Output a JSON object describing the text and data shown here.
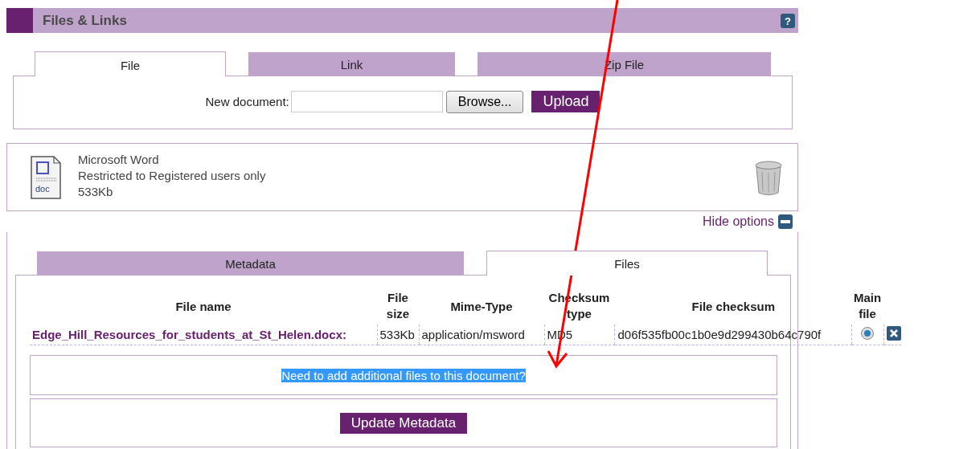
{
  "header": {
    "title": "Files & Links",
    "help": "?"
  },
  "tabs": [
    {
      "label": "File",
      "selected": true
    },
    {
      "label": "Link",
      "selected": false
    },
    {
      "label": "Zip File",
      "selected": false
    }
  ],
  "upload": {
    "label": "New document:",
    "browse": "Browse...",
    "submit": "Upload"
  },
  "document": {
    "type": "Microsoft Word",
    "access": "Restricted to Registered users only",
    "size": "533Kb",
    "icon_label": "doc"
  },
  "hide_options": "Hide options",
  "inner_tabs": [
    {
      "label": "Metadata",
      "selected": false
    },
    {
      "label": "Files",
      "selected": true
    }
  ],
  "table": {
    "columns": [
      "File name",
      "File size",
      "Mime-Type",
      "Checksum type",
      "File checksum",
      "Main file"
    ],
    "rows": [
      {
        "file_name": "Edge_Hill_Resources_for_students_at_St_Helen.docx:",
        "size": "533Kb",
        "mime": "application/msword",
        "checksum_type": "MD5",
        "checksum": "d06f535fb00c1b0e9d299430b64c790f",
        "main": true
      }
    ]
  },
  "add_files": {
    "text": "Need to add additional files to this document?",
    "highlighted": true
  },
  "update_button": "Update Metadata"
}
